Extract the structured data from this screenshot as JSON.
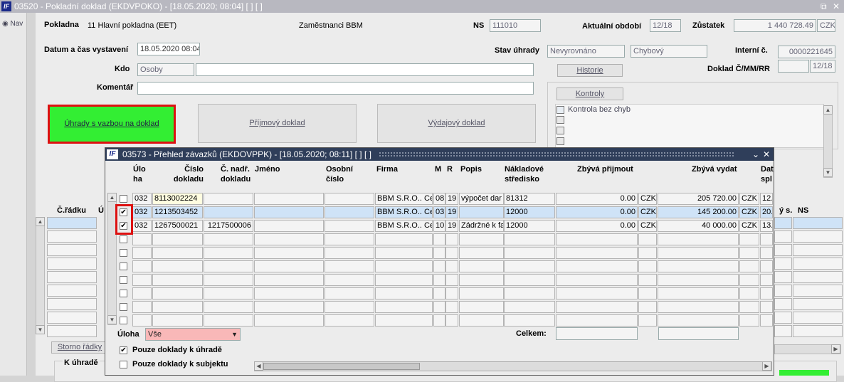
{
  "window": {
    "title": "03520 - Pokladní doklad (EKDVPOKO) - [18.05.2020; 08:04]  [ ]  [ ]",
    "restore_icon": "restore-icon",
    "close_icon": "close-icon"
  },
  "nav": {
    "label": "Nav"
  },
  "form": {
    "pokladna_label": "Pokladna",
    "pokladna_value": "11 Hlavní pokladna (EET)",
    "zamestnanci": "Zaměstnanci BBM",
    "ns_label": "NS",
    "ns_value": "111010",
    "obdobi_label": "Aktuální období",
    "obdobi_value": "12/18",
    "zustatek_label": "Zůstatek",
    "zustatek_value": "1 440 728.49",
    "zustatek_currency": "CZK",
    "datum_label": "Datum a čas vystavení",
    "datum_value": "18.05.2020 08:04",
    "stav_label": "Stav úhrady",
    "stav_value1": "Nevyrovnáno",
    "stav_value2": "Chybový",
    "interni_label": "Interní č.",
    "interni_value": "0000221645",
    "kdo_label": "Kdo",
    "kdo_value": "Osoby",
    "kdo_value2": "",
    "historie_button": "Historie",
    "doklad_label": "Doklad Č/MM/RR",
    "doklad_value1": "",
    "doklad_value2": "12/18",
    "komentar_label": "Komentář",
    "komentar_value": "",
    "kontroly_button": "Kontroly",
    "kontrola_text": "Kontrola bez chyb",
    "uhrady_button": "Úhrady s vazbou na doklad",
    "prijmovy_button": "Příjmový doklad",
    "vydajovy_button": "Výdajový doklad",
    "cradku_label": "Č.řádku",
    "cradku_label2": "Ú",
    "ys_label": "ý s.",
    "ns2_label": "NS",
    "storno_button": "Storno řádky",
    "k_uhrade_label": "K úhradě"
  },
  "dialog": {
    "title": "03573 - Přehled závazků (EKDOVPPK) - [18.05.2020; 08:11]  [ ]  [ ]",
    "headers": {
      "uloha": "Úlo ha",
      "cislo": "Číslo dokladu",
      "nadr": "Č. nadř. dokladu",
      "jmeno": "Jméno",
      "osobni": "Osobní číslo",
      "firma": "Firma",
      "m": "M",
      "r": "R",
      "popis": "Popis",
      "nakladove": "Nákladové středisko",
      "zbyva_prijmout": "Zbývá přijmout",
      "zbyva_vydat": "Zbývá vydat",
      "dat": "Dat spl"
    },
    "rows": [
      {
        "checked": false,
        "uloha": "032",
        "cislo": "8113002224",
        "nadr": "",
        "jmeno": "",
        "osobni": "",
        "firma": "BBM S.R.O.. Ce",
        "m": "08",
        "r": "19",
        "popis": "výpočet dar",
        "nakladove": "81312",
        "prijmout": "0.00",
        "cur1": "CZK",
        "vydat": "205 720.00",
        "cur2": "CZK",
        "dat": "12."
      },
      {
        "checked": true,
        "uloha": "032",
        "cislo": "1213503452",
        "nadr": "",
        "jmeno": "",
        "osobni": "",
        "firma": "BBM S.R.O.. Ce",
        "m": "03",
        "r": "19",
        "popis": "",
        "nakladove": "12000",
        "prijmout": "0.00",
        "cur1": "CZK",
        "vydat": "145 200.00",
        "cur2": "CZK",
        "dat": "20."
      },
      {
        "checked": true,
        "uloha": "032",
        "cislo": "1267500021",
        "nadr": "1217500006",
        "jmeno": "",
        "osobni": "",
        "firma": "BBM S.R.O.. Ce",
        "m": "10",
        "r": "19",
        "popis": "Zádržné k fa",
        "nakladove": "12000",
        "prijmout": "0.00",
        "cur1": "CZK",
        "vydat": "40 000.00",
        "cur2": "CZK",
        "dat": "13."
      }
    ],
    "uloha_label": "Úloha",
    "uloha_value": "Vše",
    "celkem_label": "Celkem:",
    "pouze_uhrade": "Pouze doklady k úhradě",
    "pouze_subjektu": "Pouze doklady k subjektu"
  }
}
